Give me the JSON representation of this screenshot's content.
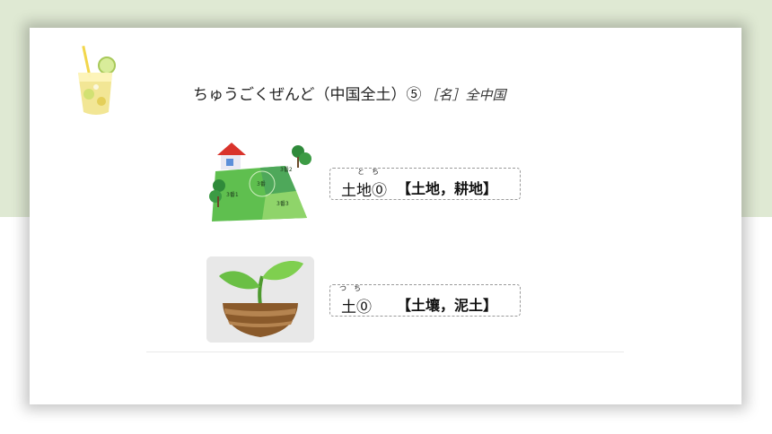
{
  "slide": {
    "title": {
      "reading": "ちゅうごくぜんど（中国全土）⑤",
      "pos": "［名］全中国"
    },
    "entries": [
      {
        "word": "土地⓪",
        "ruby": "とち",
        "meaning": "【土地，耕地】",
        "image": {
          "icon": "land-plot-map-icon",
          "labels": [
            "3番",
            "3番1",
            "3番2",
            "3番3"
          ]
        }
      },
      {
        "word": "土⓪",
        "ruby": "つち",
        "meaning": "【土壤，泥土】",
        "image": {
          "icon": "sprout-in-soil-icon"
        }
      }
    ]
  },
  "colors": {
    "band": "#dfe9d3",
    "leaf": "#6abf45",
    "soil": "#8a5a2b"
  }
}
